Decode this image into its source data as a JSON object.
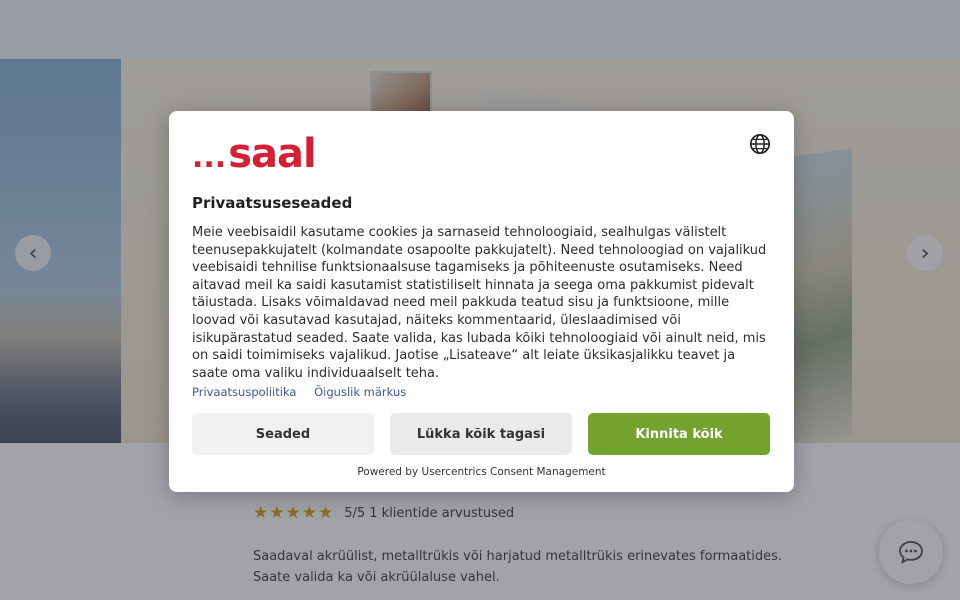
{
  "hero": {
    "arrow_left_icon": "chevron-left-icon",
    "arrow_right_icon": "chevron-right-icon",
    "arrow_left_glyph": "‹",
    "arrow_right_glyph": "›"
  },
  "product": {
    "stars": "★★★★★",
    "rating_text": "5/5 1 klientide arvustused",
    "description": "Saadaval akrüülist, metalltrükis või harjatud metalltrükis erinevates formaatides. Saate valida ka või akrüülaluse vahel."
  },
  "consent": {
    "logo_dots": "...",
    "logo_text": "saal",
    "brand_color": "#d51f34",
    "accent_color": "#74a22e",
    "language_icon": "globe-icon",
    "title": "Privaatsuseseaded",
    "body": "Meie veebisaidil kasutame cookies ja sarnaseid tehnoloogiaid, sealhulgas välistelt teenusepakkujatelt (kolmandate osapoolte pakkujatelt). Need tehnoloogiad on vajalikud veebisaidi tehnilise funktsionaalsuse tagamiseks ja põhiteenuste osutamiseks. Need aitavad meil ka saidi kasutamist statistiliselt hinnata ja seega oma pakkumist pidevalt täiustada. Lisaks võimaldavad need meil pakkuda teatud sisu ja funktsioone, mille loovad või kasutavad kasutajad, näiteks kommentaarid, üleslaadimised või isikupärastatud seaded. Saate valida, kas lubada kõiki tehnoloogiaid või ainult neid, mis on saidi toimimiseks vajalikud. Jaotise „Lisateave“ alt leiate üksikasjalikku teavet ja saate oma valiku individuaalselt teha.",
    "link_privacy": "Privaatsuspoliitika",
    "link_legal": "Õiguslik märkus",
    "btn_settings": "Seaded",
    "btn_reject": "Lükka kõik tagasi",
    "btn_accept": "Kinnita kõik",
    "powered_by": "Powered by Usercentrics Consent Management"
  },
  "chat": {
    "icon": "chat-icon"
  }
}
